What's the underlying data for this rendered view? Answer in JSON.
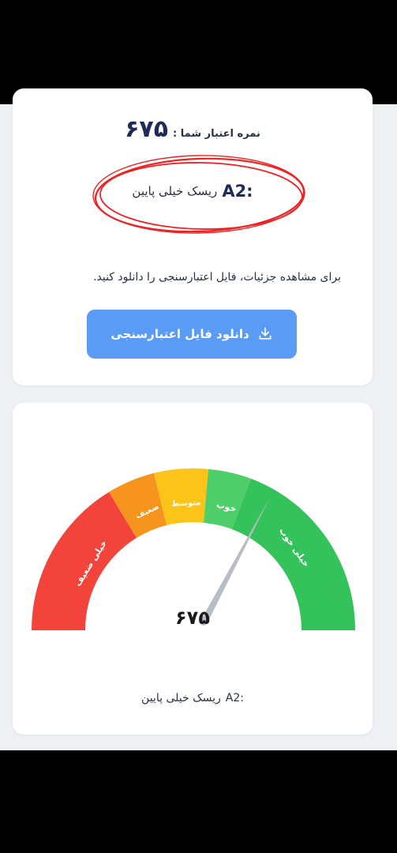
{
  "score": {
    "label": "نمره اعتبار شما :",
    "value": "۶۷۵"
  },
  "risk": {
    "code": "A2:",
    "text": "ریسک خیلی پایین"
  },
  "info_text": "برای مشاهده جزئیات، فایل اعتبارسنجی را دانلود کنید.",
  "download_button": {
    "label": "دانلود فایل اعتبارسنجی",
    "icon": "download-icon"
  },
  "gauge": {
    "segments": [
      {
        "label": "خیلی ضعیف",
        "color": "#f2443a"
      },
      {
        "label": "ضعیف",
        "color": "#f7941d"
      },
      {
        "label": "متوسط",
        "color": "#fcc419"
      },
      {
        "label": "خوب",
        "color": "#4fcf6a"
      },
      {
        "label": "خیلی خوب",
        "color": "#34c25a"
      }
    ],
    "value": "۶۷۵"
  },
  "bottom_risk": {
    "code": "A2:",
    "text": "ریسک خیلی پایین"
  }
}
